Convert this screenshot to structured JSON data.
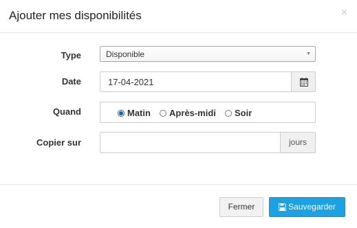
{
  "modal": {
    "title": "Ajouter mes disponibilités",
    "close_symbol": "×"
  },
  "form": {
    "type": {
      "label": "Type",
      "selected": "Disponible"
    },
    "date": {
      "label": "Date",
      "value": "17-04-2021",
      "icon": "calendar-icon"
    },
    "quand": {
      "label": "Quand",
      "options": [
        {
          "label": "Matin",
          "checked": true
        },
        {
          "label": "Après-midi",
          "checked": false
        },
        {
          "label": "Soir",
          "checked": false
        }
      ]
    },
    "copier_sur": {
      "label": "Copier sur",
      "value": "",
      "addon": "jours"
    }
  },
  "footer": {
    "close_label": "Fermer",
    "save_label": "Sauvegarder",
    "save_icon": "floppy-disk-icon"
  },
  "colors": {
    "primary": "#1da1e0",
    "radio_checked": "#1e5ea8"
  }
}
